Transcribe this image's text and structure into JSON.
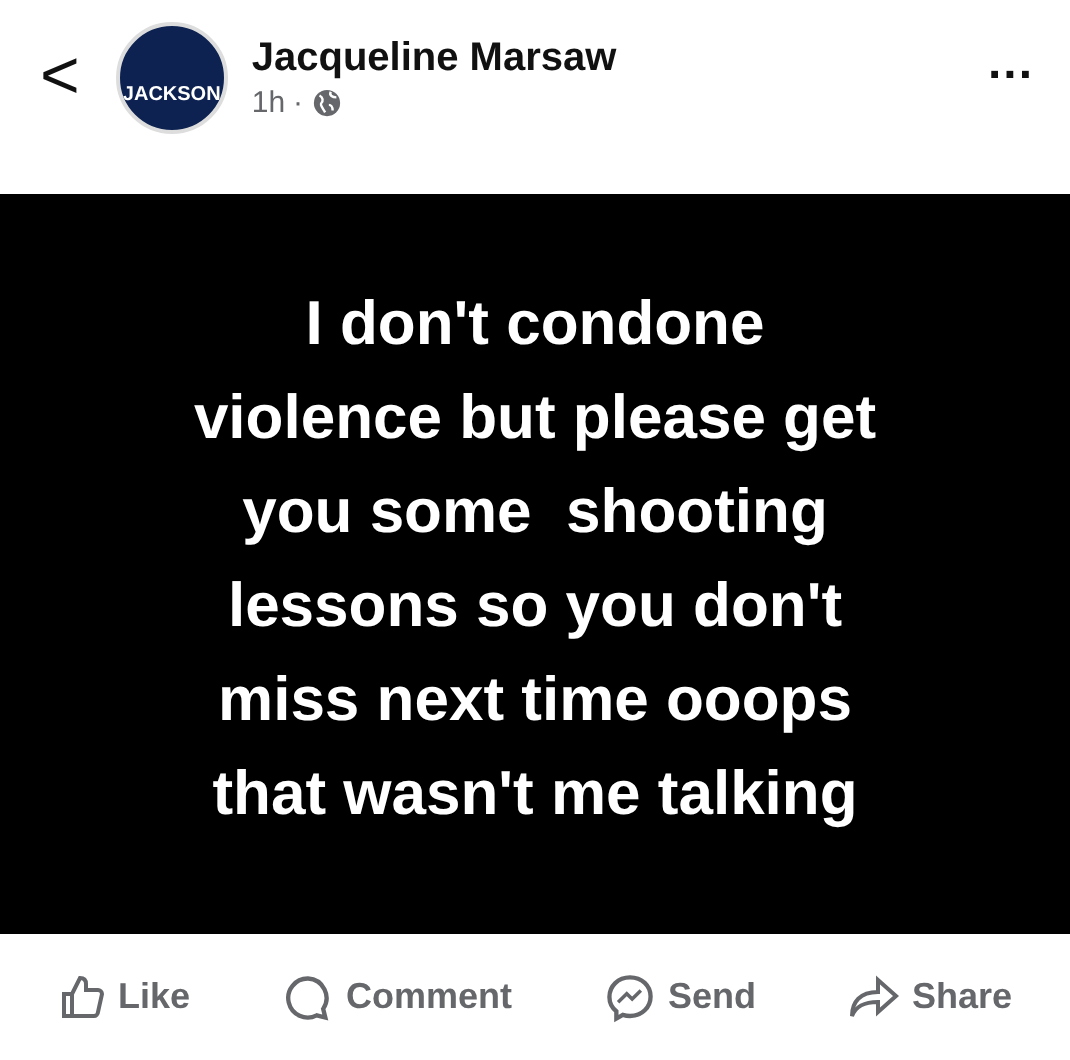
{
  "header": {
    "back": "<",
    "author": "Jacqueline Marsaw",
    "avatar_text": "JACKSON",
    "time": "1h",
    "separator": "·",
    "more": "..."
  },
  "post": {
    "lines": [
      "I don't condone",
      "violence but please get",
      "you some  shooting",
      "lessons so you don't",
      "miss next time ooops",
      "that wasn't me talking"
    ]
  },
  "actions": [
    {
      "kind": "like",
      "label": "Like"
    },
    {
      "kind": "comment",
      "label": "Comment"
    },
    {
      "kind": "send",
      "label": "Send"
    },
    {
      "kind": "share",
      "label": "Share"
    }
  ]
}
